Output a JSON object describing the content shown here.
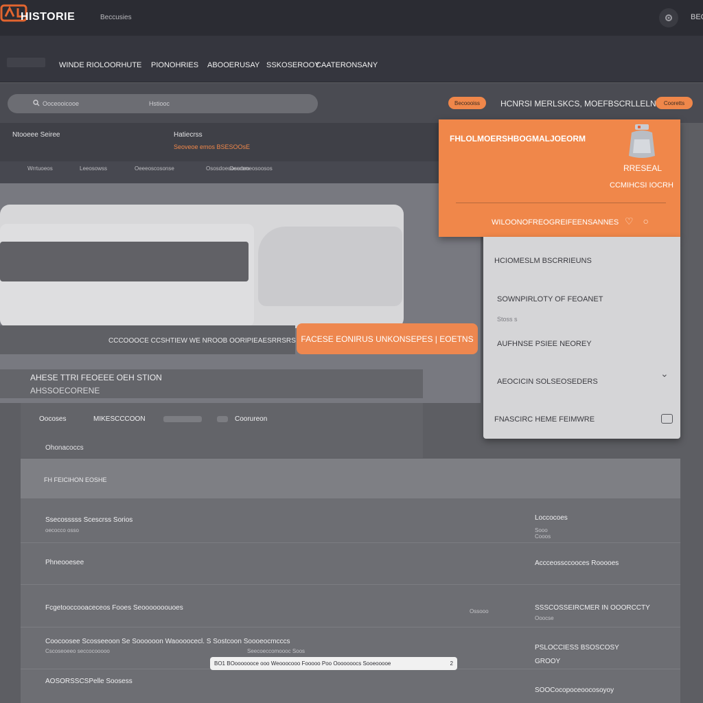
{
  "header": {
    "brand": "HISTORIE",
    "brand_sub": "Beccusies",
    "user_label": "BEO"
  },
  "nav": {
    "items": [
      "WINDE RIOLOORHUTE",
      "PIONOHRIES",
      "ABOOERUSAY",
      "SSKOSEROOY",
      "CAATERONSANY"
    ]
  },
  "search": {
    "placeholder": "Ooceooicooe",
    "placeholder_right": "Hstiooc",
    "pill_left": "Becoooiss",
    "right_text": "HCNRSI MERLSKCS, MOEFBSCRLLELN",
    "pill_right": "Cooretts"
  },
  "info": {
    "left_label": "Ntooeee Seiree",
    "right_label": "Hatiecrss",
    "right_sub": "Seoveoe emos BSESOOsE",
    "filters": [
      "Wrrtuoeos",
      "Leeosowss",
      "Oeeeoscosonse",
      "Ososdoeuosurom",
      "Oeedeoeosoosos"
    ]
  },
  "hero": {
    "caption": "CCCOOOCE CCSHTIEW",
    "caption2": "WE NROOB OORIPIEAESRRSRS",
    "button": "FACESE EONIRUS UNKONSEPES | EOETNS",
    "section_title": "AHESE TTRI FEOEEE OEH STION",
    "section_sub": "AHSSOECORENE"
  },
  "promo_card": {
    "title": "FHLOLMOERSHBOGMALJOEORM",
    "price": "RRESEAL",
    "sub": "CCMIHCSI IOCRH",
    "footer": "WILOONOFREOGREIFEENSANNES",
    "icons": [
      "heart-icon",
      "circle-icon"
    ]
  },
  "dropdown": {
    "items": [
      {
        "label": "HCIOMESLM BSCRRIEUNS",
        "sub": ""
      },
      {
        "label": "SOWNPIRLOTY OF FEOANET",
        "sub": "Stoss s"
      },
      {
        "label": "AUFHNSE PSIEE NEOREY",
        "sub": ""
      },
      {
        "label": "AEOCICIN SOLSEOSEDERS",
        "sub": ""
      },
      {
        "label": "FNASCIRC HEME FEIMWRE",
        "sub": ""
      }
    ]
  },
  "tabs": {
    "items": [
      "Oocoses",
      "MIKESCCCOON",
      "Coorureon"
    ],
    "label": "Ohonacoccs"
  },
  "table": {
    "header": "FH FEICIHON EOSHE",
    "rows": [
      {
        "left": "Ssecosssss Scescrss Sorios",
        "left_sub": "oecocco osso",
        "right": "Loccocoes",
        "right_sub": "Sooo Cooos"
      },
      {
        "left": "Phneooesee",
        "left_sub": "",
        "right": "Accceossccooces Rooooes",
        "right_sub": ""
      },
      {
        "left": "Fcgetooccooaceceos Fooes Seooooooouoes",
        "left_sub": "",
        "mid": "Ossooo",
        "right": "SSSCOSSEIRCMER IN OOORCCTY",
        "right_sub": "Ooocse"
      },
      {
        "left": "Coocoosee Scosseeoon Se Soooooon Waoooocecl. S Sostcoon Soooeocmcccs",
        "left_sub": "Cscoseoeeo seccocooooo",
        "mid": "Seecoeccomoooc Soos",
        "right": "PSLOCCIESS BSOSCOSY",
        "right_sub": "GROOY"
      },
      {
        "left": "AOSORSSCSPelle Soosess",
        "left_sub": "",
        "right": "SOOCocopoceoocosoyoy",
        "right_sub": ""
      }
    ],
    "tooltip": "BO1 BOooooooce ooo Weooocooo Fooooo Poo Ooooooocs Sooeooooe"
  },
  "colors": {
    "accent": "#f0874a",
    "topbar": "#2b2c33",
    "navbar": "#35363e",
    "panel": "#d5d5d7"
  }
}
